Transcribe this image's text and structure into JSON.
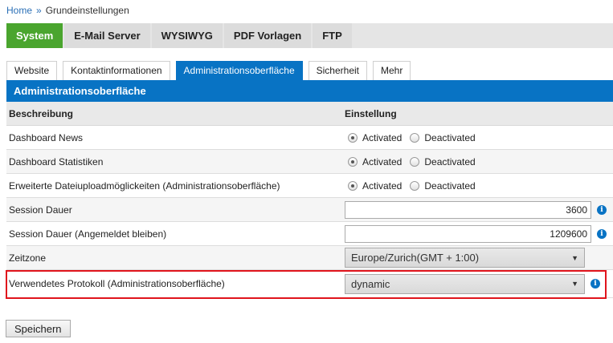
{
  "breadcrumb": {
    "home": "Home",
    "separator": "»",
    "current": "Grundeinstellungen"
  },
  "main_tabs": [
    "System",
    "E-Mail Server",
    "WYSIWYG",
    "PDF Vorlagen",
    "FTP"
  ],
  "sub_tabs": [
    "Website",
    "Kontaktinformationen",
    "Administrationsoberfläche",
    "Sicherheit",
    "Mehr"
  ],
  "panel_title": "Administrationsoberfläche",
  "table": {
    "col_description": "Beschreibung",
    "col_setting": "Einstellung",
    "radio_on": "Activated",
    "radio_off": "Deactivated",
    "rows": [
      {
        "label": "Dashboard News",
        "selected": "Activated"
      },
      {
        "label": "Dashboard Statistiken",
        "selected": "Activated"
      },
      {
        "label": "Erweiterte Dateiuploadmöglickeiten (Administrationsoberfläche)",
        "selected": "Activated"
      },
      {
        "label": "Session Dauer",
        "value": "3600"
      },
      {
        "label": "Session Dauer (Angemeldet bleiben)",
        "value": "1209600"
      },
      {
        "label": "Zeitzone",
        "value": "Europe/Zurich(GMT + 1:00)"
      },
      {
        "label": "Verwendetes Protokoll (Administrationsoberfläche)",
        "value": "dynamic"
      }
    ]
  },
  "save_label": "Speichern",
  "icons": {
    "info": "info-icon",
    "dropdown": "chevron-down-icon"
  },
  "colors": {
    "primary_blue": "#0873c4",
    "active_green": "#4aa52e",
    "highlight_red": "#e0141c"
  }
}
